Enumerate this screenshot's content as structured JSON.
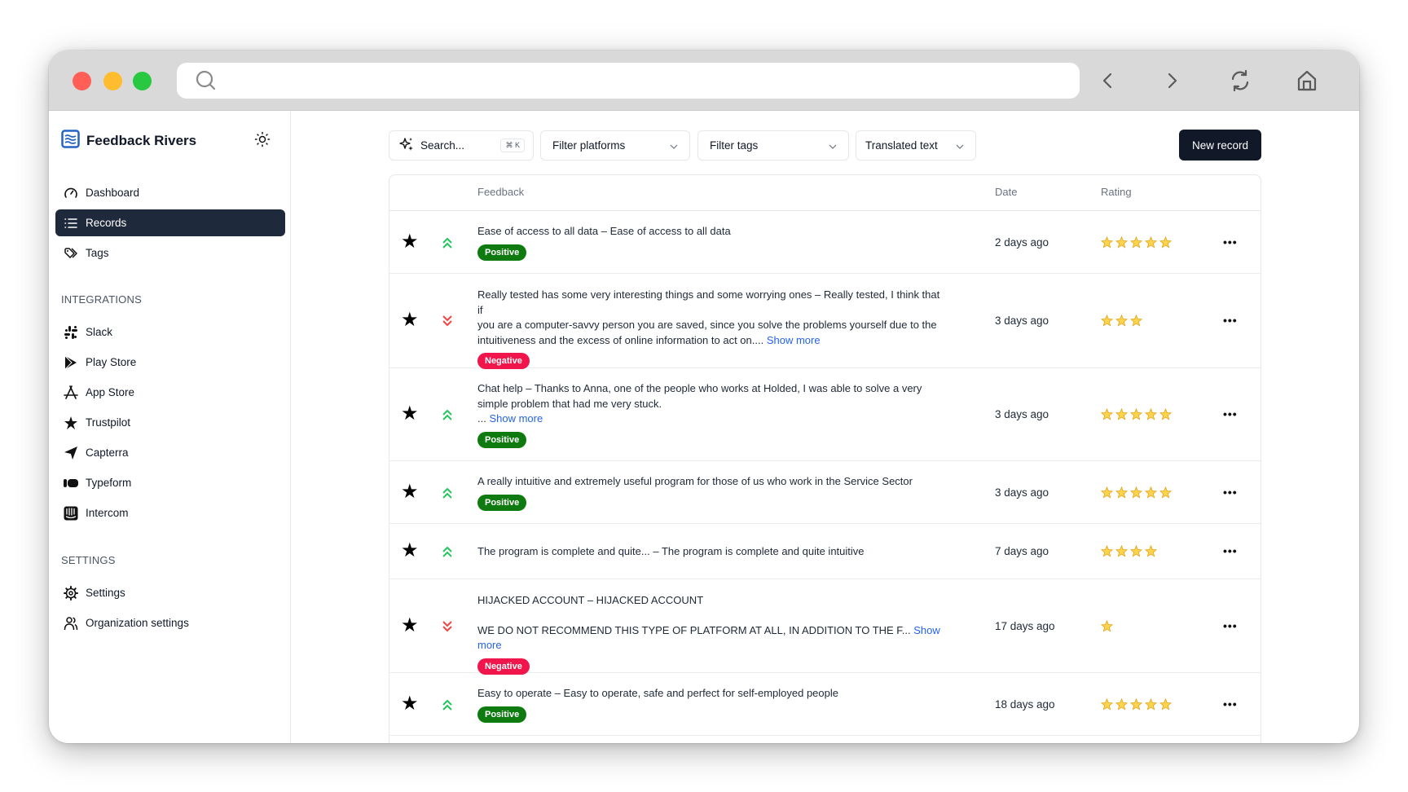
{
  "browser": {
    "url_value": "",
    "nav": [
      "back",
      "forward",
      "reload",
      "home"
    ]
  },
  "sidebar": {
    "brand": "Feedback Rivers",
    "items": [
      {
        "label": "Dashboard",
        "icon": "gauge-icon",
        "active": false
      },
      {
        "label": "Records",
        "icon": "list-icon",
        "active": true
      },
      {
        "label": "Tags",
        "icon": "tags-icon",
        "active": false
      }
    ],
    "integrations_label": "INTEGRATIONS",
    "integrations": [
      {
        "label": "Slack",
        "icon": "slack-icon"
      },
      {
        "label": "Play Store",
        "icon": "play-store-icon"
      },
      {
        "label": "App Store",
        "icon": "app-store-icon"
      },
      {
        "label": "Trustpilot",
        "icon": "trustpilot-icon"
      },
      {
        "label": "Capterra",
        "icon": "capterra-icon"
      },
      {
        "label": "Typeform",
        "icon": "typeform-icon"
      },
      {
        "label": "Intercom",
        "icon": "intercom-icon"
      }
    ],
    "settings_label": "SETTINGS",
    "settings": [
      {
        "label": "Settings",
        "icon": "gear-icon"
      },
      {
        "label": "Organization settings",
        "icon": "users-icon"
      }
    ]
  },
  "toolbar": {
    "search_placeholder": "Search...",
    "search_shortcut": "⌘ K",
    "filter_platforms": "Filter platforms",
    "filter_tags": "Filter tags",
    "translated": "Translated text",
    "new_record": "New record"
  },
  "table": {
    "columns": [
      "Feedback",
      "Date",
      "Rating"
    ],
    "rows": [
      {
        "lines": [
          "Ease of access to all data – Ease of access to all data"
        ],
        "show_more": "",
        "sentiment": "Positive",
        "trend": "up",
        "date": "2 days ago",
        "rating": 5
      },
      {
        "lines": [
          "Really tested has some very interesting things and some worrying ones – Really tested, I think that if",
          "you are a computer-savvy person you are saved, since you solve the problems yourself due to the",
          "intuitiveness and the excess of online information to act on.... "
        ],
        "show_more": "Show more",
        "sentiment": "Negative",
        "trend": "down",
        "date": "3 days ago",
        "rating": 3
      },
      {
        "lines": [
          "Chat help – Thanks to Anna, one of the people who works at Holded, I was able to solve a very",
          "simple problem that had me very stuck.",
          "... "
        ],
        "show_more": "Show more",
        "sentiment": "Positive",
        "trend": "up",
        "date": "3 days ago",
        "rating": 5
      },
      {
        "lines": [
          "A really intuitive and extremely useful program for those of us who work in the Service Sector"
        ],
        "show_more": "",
        "sentiment": "Positive",
        "trend": "up",
        "date": "3 days ago",
        "rating": 5
      },
      {
        "lines": [
          "The program is complete and quite... – The program is complete and quite intuitive"
        ],
        "show_more": "",
        "sentiment": "",
        "trend": "up",
        "date": "7 days ago",
        "rating": 4
      },
      {
        "lines": [
          "HIJACKED ACCOUNT – HIJACKED ACCOUNT",
          "",
          "WE DO NOT RECOMMEND THIS TYPE OF PLATFORM AT ALL, IN ADDITION TO THE F... "
        ],
        "show_more": "Show more",
        "sentiment": "Negative",
        "trend": "down",
        "date": "17 days ago",
        "rating": 1
      },
      {
        "lines": [
          "Easy to operate – Easy to operate, safe and perfect for self-employed people"
        ],
        "show_more": "",
        "sentiment": "Positive",
        "trend": "up",
        "date": "18 days ago",
        "rating": 5
      }
    ]
  },
  "colors": {
    "positive": "#0f7a0f",
    "negative": "#f0154b",
    "trend_up": "#22c55e",
    "trend_down": "#ef4444",
    "link": "#2563eb",
    "star": "#f5b301",
    "active_nav": "#1e293b"
  }
}
